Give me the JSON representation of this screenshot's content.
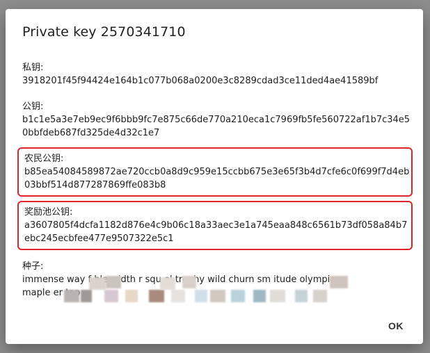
{
  "dialog": {
    "title": "Private key 2570341710",
    "private_key": {
      "label": "私钥:",
      "value": "3918201f45f94424e164b1c077b068a0200e3c8289cdad3ce11ded4ae41589bf"
    },
    "public_key": {
      "label": "公钥:",
      "value": "b1c1e5a3e7eb9ec9f6bbb9fc7e875c66de770a210eca1c7969fb5fe560722af1b7c34e50bbfdeb687fd325de4d32c1e7"
    },
    "farmer_public_key": {
      "label": "农民公钥:",
      "value": "b85ea54084589872ae720ccb0a8d9c959e15ccbb675e3e65f3b4d7cfe6c0f699f7d4eb03bbf514d877287869ffe083b8"
    },
    "pool_public_key": {
      "label": "奖励池公钥:",
      "value": "a3607805f4dcfa1182d876e4c9b06c18a33aec3e1a745eaa848c6561b73df058a84b7ebc245ecbfee477e9507322e5c1"
    },
    "seed": {
      "label": "种子:",
      "line1": "immense way f        ble width       r squ   el trophy wild churn sm      itude olympic",
      "line2": "maple       er tap"
    },
    "ok_label": "OK"
  },
  "colors": {
    "highlight_border": "#e0252d",
    "backdrop": "#8d8d8d"
  }
}
